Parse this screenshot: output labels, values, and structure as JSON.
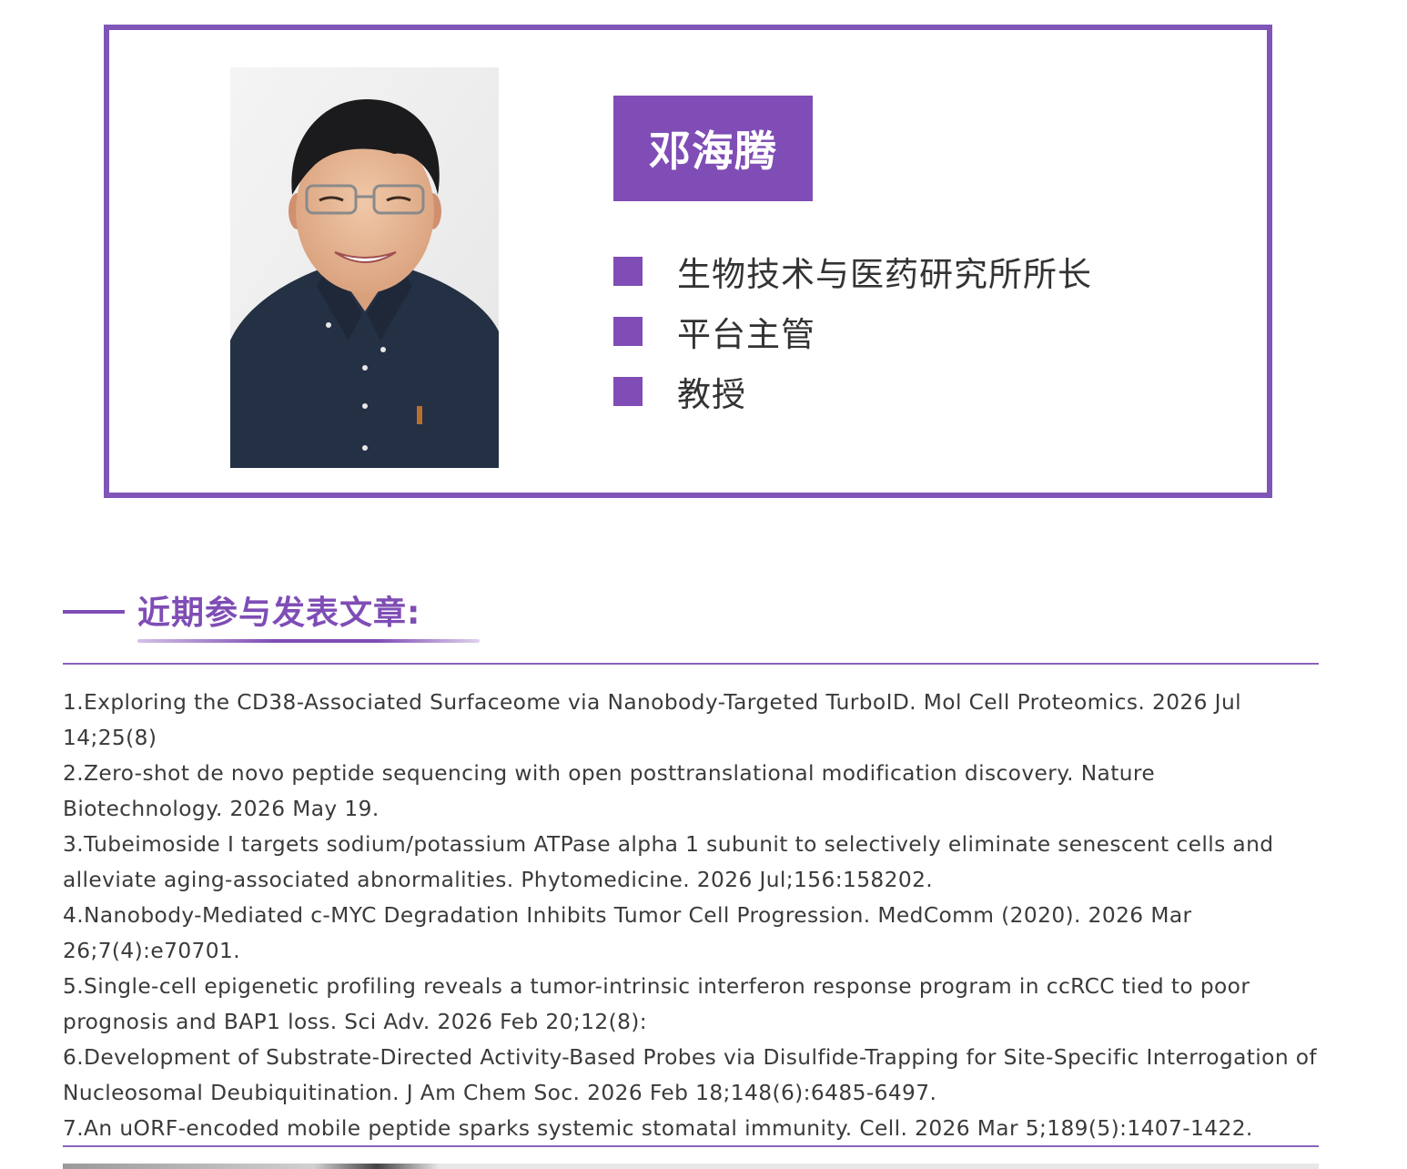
{
  "profile": {
    "name": "邓海腾",
    "titles": [
      "生物技术与医药研究所所长",
      "平台主管",
      "教授"
    ]
  },
  "publications": {
    "heading": "近期参与发表文章:",
    "items": [
      "1.Exploring the CD38-Associated Surfaceome via Nanobody-Targeted TurboID. Mol Cell Proteomics. 2026 Jul 14;25(8)",
      "2.Zero-shot de novo peptide sequencing with open posttranslational modification discovery. Nature Biotechnology. 2026 May 19.",
      "3.Tubeimoside I targets sodium/potassium ATPase alpha 1 subunit to selectively eliminate senescent cells and alleviate aging-associated abnormalities. Phytomedicine. 2026 Jul;156:158202.",
      "4.Nanobody-Mediated c-MYC Degradation Inhibits Tumor Cell Progression. MedComm (2020). 2026 Mar 26;7(4):e70701.",
      "5.Single-cell epigenetic profiling reveals a tumor-intrinsic interferon response program in ccRCC tied to poor prognosis and BAP1 loss. Sci Adv. 2026 Feb 20;12(8):",
      "6.Development of Substrate-Directed Activity-Based Probes via Disulfide-Trapping for Site-Specific Interrogation of Nucleosomal Deubiquitination. J Am Chem Soc. 2026 Feb 18;148(6):6485-6497.",
      "7.An uORF-encoded mobile peptide sparks systemic stomatal immunity. Cell. 2026 Mar 5;189(5):1407-1422."
    ]
  },
  "colors": {
    "accent": "#7f4db5",
    "border": "#7f56b8",
    "text": "#3a3a3a"
  }
}
